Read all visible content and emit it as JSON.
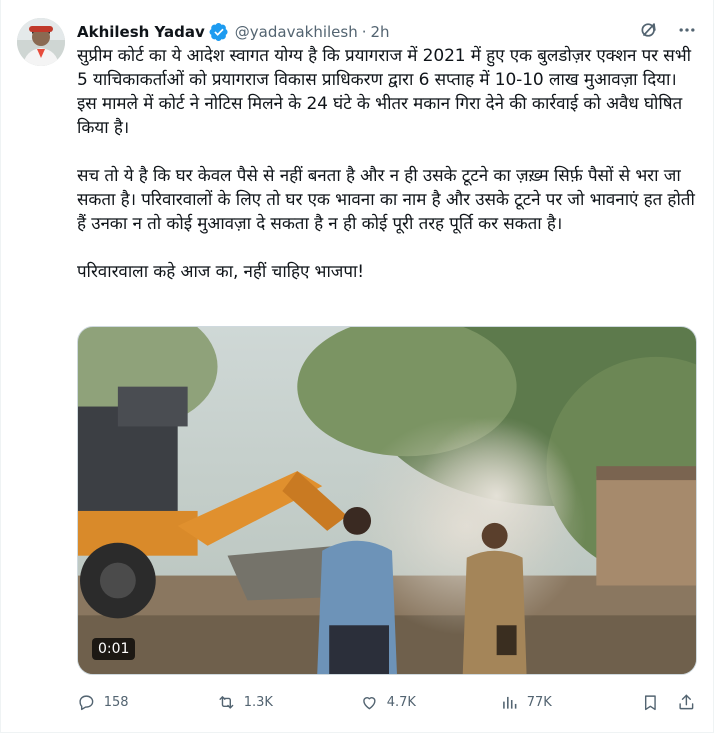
{
  "author": {
    "name": "Akhilesh Yadav",
    "handle": "@yadavakhilesh",
    "separator": "·",
    "time": "2h",
    "verified": true,
    "verified_color": "#1d9bf0"
  },
  "header_icons": [
    "grok-icon",
    "more-icon"
  ],
  "tweet_text": {
    "paragraphs": [
      "सुप्रीम कोर्ट का ये आदेश स्वागत योग्य है कि प्रयागराज में 2021 में हुए एक बुलडोज़र एक्शन पर सभी 5 याचिकाकर्ताओं को प्रयागराज विकास प्राधिकरण द्वारा 6 सप्ताह में 10-10 लाख मुआवज़ा दिया। इस मामले में कोर्ट ने नोटिस मिलने के 24 घंटे के भीतर मकान गिरा देने की कार्रवाई को अवैध घोषित किया है।",
      "सच तो ये है कि घर केवल पैसे से नहीं बनता है और न ही उसके टूटने का ज़ख़्म सिर्फ़ पैसों से भरा जा सकता है। परिवारवालों के लिए तो घर एक भावना का नाम है और उसके टूटने पर जो भावनाएं हत होती हैं उनका न तो कोई मुआवज़ा दे सकता है न ही कोई पूरी तरह पूर्ति कर सकता है।",
      "परिवारवाला कहे आज का, नहीं चाहिए भाजपा!"
    ]
  },
  "media": {
    "type": "video",
    "duration": "0:01"
  },
  "actions": {
    "replies": "158",
    "reposts": "1.3K",
    "likes": "4.7K",
    "views": "77K"
  },
  "colors": {
    "text": "#0f1419",
    "secondary": "#536471",
    "border": "#cfd9de",
    "accent": "#1d9bf0"
  }
}
